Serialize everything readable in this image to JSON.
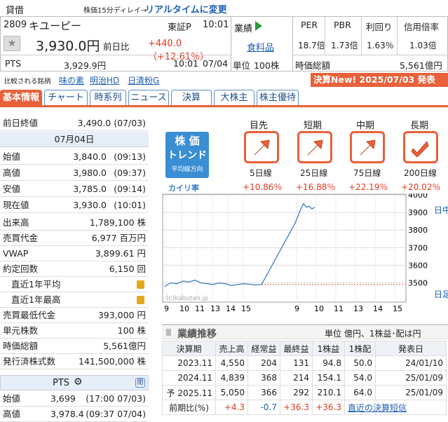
{
  "header": {
    "category": "貸借",
    "delay_note": "株価15分ディレイ→",
    "realtime_link": "リアルタイムに変更"
  },
  "stock": {
    "code": "2809",
    "name": "キユーピー",
    "market": "東証P",
    "time": "10:01",
    "price": "3,930.0円",
    "prev_label": "前日比",
    "change": "+440.0（+12.61％）"
  },
  "pts": {
    "label": "PTS",
    "price": "3,929.9円",
    "time": "10:01",
    "date": "07/04"
  },
  "gyoseki": {
    "label": "業績",
    "sector": "食料品",
    "unit_label": "単位",
    "unit": "100株"
  },
  "ratios": {
    "per_label": "PER",
    "pbr_label": "PBR",
    "yield_label": "利回り",
    "margin_label": "信用倍率",
    "per": "18.7倍",
    "pbr": "1.73倍",
    "yield": "1.63％",
    "margin": "1.03倍"
  },
  "market_cap": {
    "label": "時価総額",
    "value": "5,561億円"
  },
  "compare": {
    "label": "比較される銘柄",
    "items": [
      "味の素",
      "明治HD",
      "日清粉G"
    ]
  },
  "kessan_banner": "決算New! 2025/07/03 発表",
  "tabs": [
    "基本情報",
    "チャート",
    "時系列",
    "ニュース",
    "決算",
    "大株主",
    "株主優待"
  ],
  "prev_close": {
    "label": "前日終値",
    "value": "3,490.0 (07/03)"
  },
  "date_header": "07月04日",
  "ohlc": [
    {
      "k": "始値",
      "v": "3,840.0",
      "t": "(09:13)"
    },
    {
      "k": "高値",
      "v": "3,980.0",
      "t": "(09:37)"
    },
    {
      "k": "安値",
      "v": "3,785.0",
      "t": "(09:14)"
    },
    {
      "k": "現在値",
      "v": "3,930.0",
      "t": "(10:01)"
    }
  ],
  "stats": [
    {
      "k": "出来高",
      "v": "1,789,100 株"
    },
    {
      "k": "売買代金",
      "v": "6,977 百万円"
    },
    {
      "k": "VWAP",
      "v": "3,899.61 円"
    },
    {
      "k": "約定回数",
      "v": "6,150 回"
    },
    {
      "k": "直近1年平均",
      "v": ""
    },
    {
      "k": "直近1年最高",
      "v": ""
    },
    {
      "k": "売買最低代金",
      "v": "393,000 円"
    },
    {
      "k": "単元株数",
      "v": "100 株"
    },
    {
      "k": "時価総額",
      "v": "5,561億円"
    },
    {
      "k": "発行済株式数",
      "v": "141,500,000 株"
    }
  ],
  "pts_box": {
    "title": "PTS",
    "close_label": "閉",
    "rows": [
      {
        "k": "始値",
        "v": "3,699",
        "t": "(17:00 07/03)"
      },
      {
        "k": "高値",
        "v": "3,978.4",
        "t": "(09:37 07/04)"
      }
    ]
  },
  "trend": {
    "title1": "株 価",
    "title2": "トレンド",
    "sub": "平均線方向",
    "kairi_label": "カイリ率",
    "cols": [
      {
        "period": "目先",
        "line": "5日線",
        "rate": "+10.86％"
      },
      {
        "period": "短期",
        "line": "25日線",
        "rate": "+16.88％"
      },
      {
        "period": "中期",
        "line": "75日線",
        "rate": "+22.19％"
      },
      {
        "period": "長期",
        "line": "200日線",
        "rate": "+20.02％"
      }
    ]
  },
  "chart_data": {
    "type": "line",
    "ylim": [
      3450,
      4000
    ],
    "yticks": [
      "4000",
      "3900",
      "3800",
      "3700",
      "3600",
      "3500"
    ],
    "xticks": [
      "9",
      "10",
      "11",
      "13",
      "14",
      "15",
      "9",
      "10",
      "11",
      "13",
      "14",
      "15"
    ],
    "watermark": "(c)kabutan.jp",
    "side_label": "日中足",
    "side_label2": "日足",
    "series": [
      {
        "values": [
          3480,
          3500,
          3495,
          3510,
          3505,
          3515,
          3500,
          3495,
          3490,
          3500,
          3495,
          3485,
          3490,
          3495,
          3492,
          3488,
          3490,
          3840,
          3880,
          3920,
          3950,
          3930,
          3935,
          3920,
          3930
        ]
      }
    ]
  },
  "perf": {
    "title": "業績推移",
    "unit": "単位 億円、1株益･配は円",
    "header": [
      "決算期",
      "売上高",
      "経常益",
      "最終益",
      "1株益",
      "1株配",
      "発表日"
    ],
    "rows": [
      [
        "2023.11",
        "4,550",
        "204",
        "131",
        "94.8",
        "50.0",
        "24/01/10"
      ],
      [
        "2024.11",
        "4,839",
        "368",
        "214",
        "154.1",
        "54.0",
        "25/01/09"
      ],
      [
        "予 2025.11",
        "5,050",
        "366",
        "292",
        "210.1",
        "64.0",
        "25/01/09"
      ]
    ],
    "compare_label": "前期比(%)",
    "compare": [
      "+4.3",
      "-0.7",
      "+36.3",
      "+36.3"
    ],
    "link": "直近の決算短信"
  }
}
